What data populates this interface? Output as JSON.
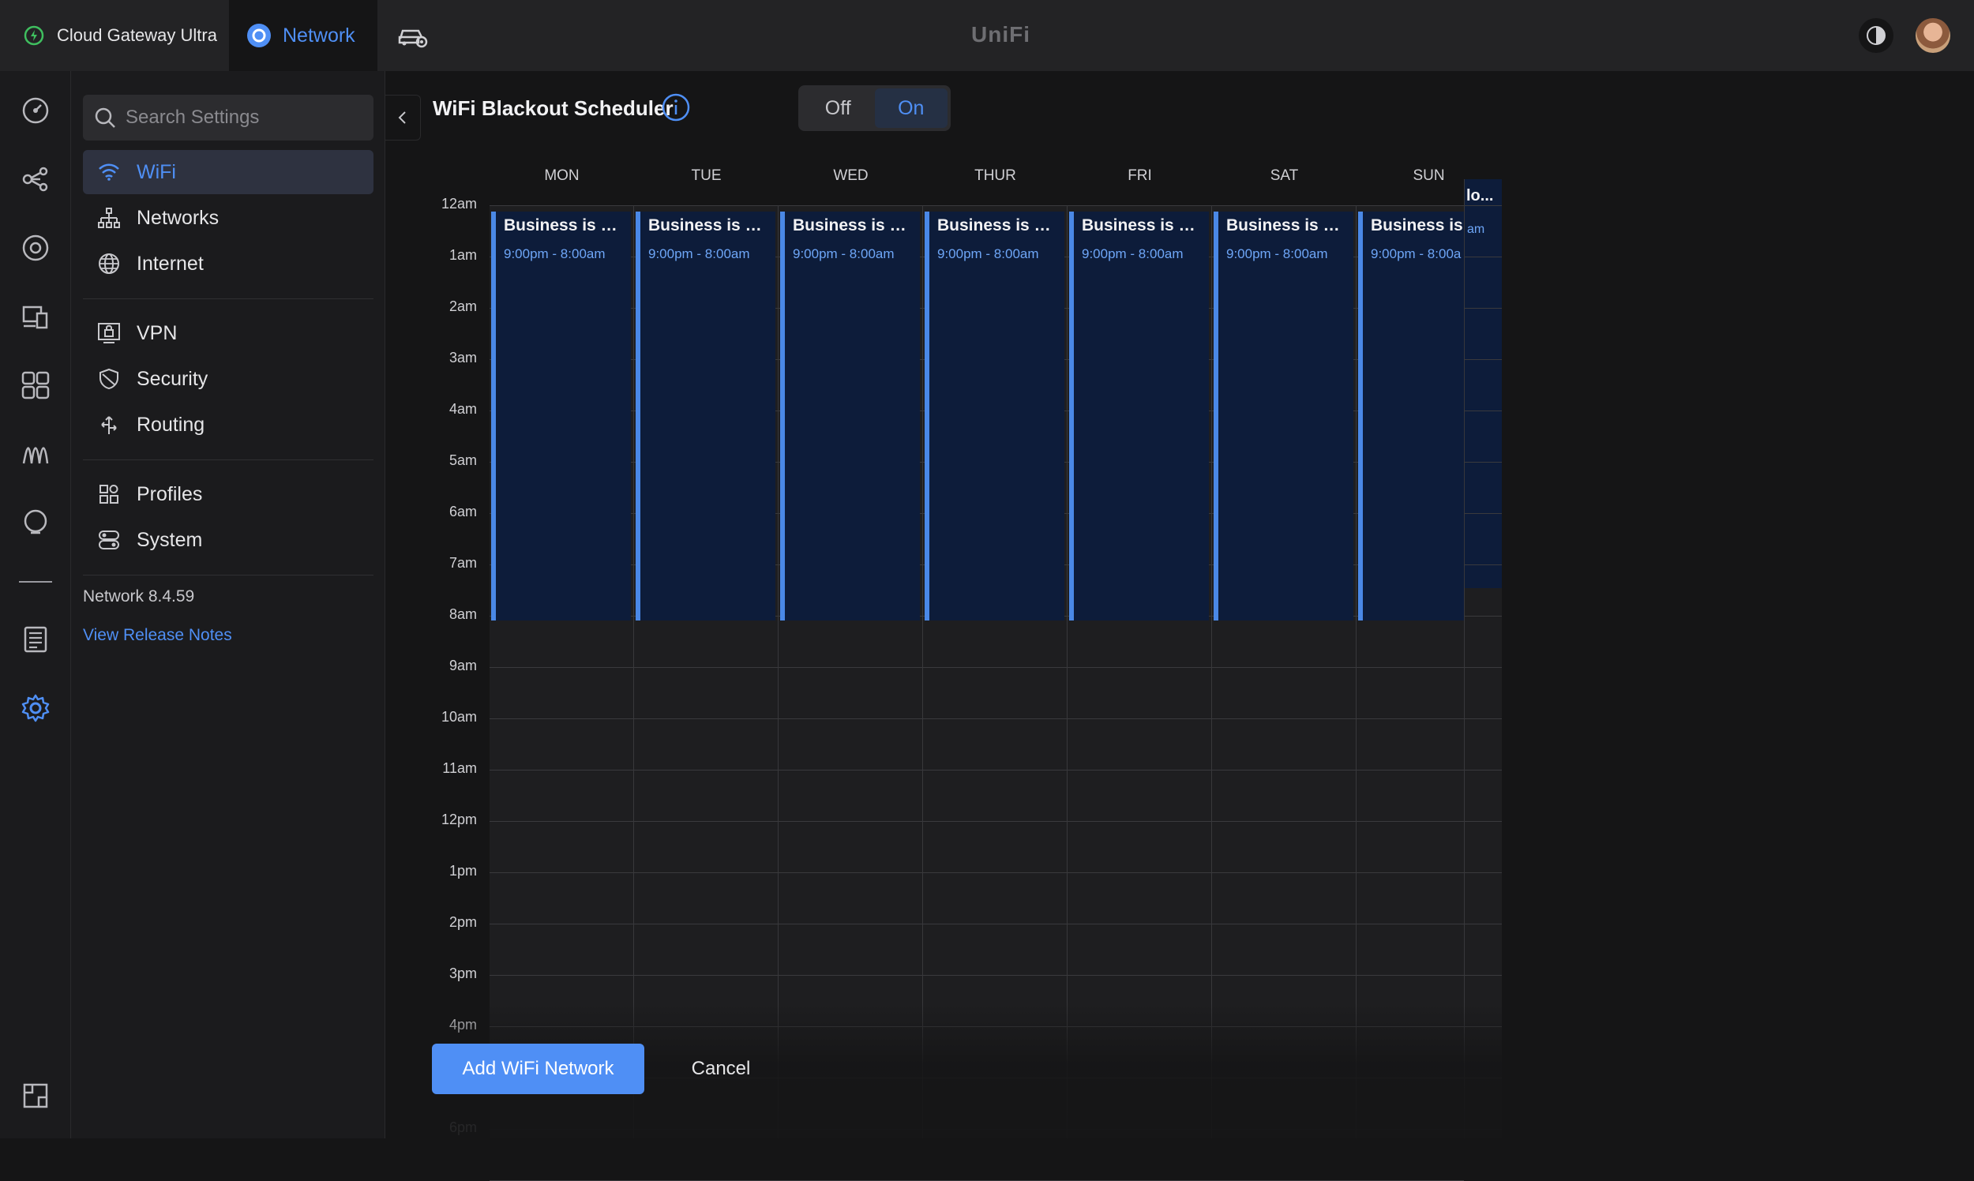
{
  "topbar": {
    "gateway_label": "Cloud Gateway Ultra",
    "app_label": "Network",
    "brand": "UniFi"
  },
  "settings": {
    "search_placeholder": "Search Settings",
    "menu": [
      {
        "label": "WiFi",
        "icon": "wifi-icon",
        "active": true
      },
      {
        "label": "Networks",
        "icon": "networks-icon"
      },
      {
        "label": "Internet",
        "icon": "globe-icon"
      },
      {
        "label": "VPN",
        "icon": "vpn-icon"
      },
      {
        "label": "Security",
        "icon": "shield-icon"
      },
      {
        "label": "Routing",
        "icon": "routing-icon"
      },
      {
        "label": "Profiles",
        "icon": "profiles-icon"
      },
      {
        "label": "System",
        "icon": "system-icon"
      }
    ],
    "version": "Network 8.4.59",
    "release_notes": "View Release Notes"
  },
  "scheduler": {
    "title": "WiFi Blackout Scheduler",
    "toggle_off": "Off",
    "toggle_on": "On",
    "toggle_state": "On",
    "days": [
      "MON",
      "TUE",
      "WED",
      "THUR",
      "FRI",
      "SAT",
      "SUN"
    ],
    "hours": [
      "12am",
      "1am",
      "2am",
      "3am",
      "4am",
      "5am",
      "6am",
      "7am",
      "8am",
      "9am",
      "10am",
      "11am",
      "12pm",
      "1pm",
      "2pm",
      "3pm",
      "4pm",
      "",
      "6pm"
    ],
    "events": [
      {
        "title": "Business is clo...",
        "time": "9:00pm - 8:00am"
      },
      {
        "title": "Business is clo...",
        "time": "9:00pm - 8:00am"
      },
      {
        "title": "Business is clo...",
        "time": "9:00pm - 8:00am"
      },
      {
        "title": "Business is clo...",
        "time": "9:00pm - 8:00am"
      },
      {
        "title": "Business is clo...",
        "time": "9:00pm - 8:00am"
      },
      {
        "title": "Business is clo...",
        "time": "9:00pm - 8:00am"
      },
      {
        "title": "Business is c",
        "time": "9:00pm - 8:00a"
      }
    ],
    "overflow_title": "lo...",
    "overflow_time": "am"
  },
  "actions": {
    "primary": "Add WiFi Network",
    "secondary": "Cancel"
  },
  "colors": {
    "accent": "#4f8ff5",
    "event_bg": "#0d1c3a",
    "event_border": "#4a88e6"
  }
}
